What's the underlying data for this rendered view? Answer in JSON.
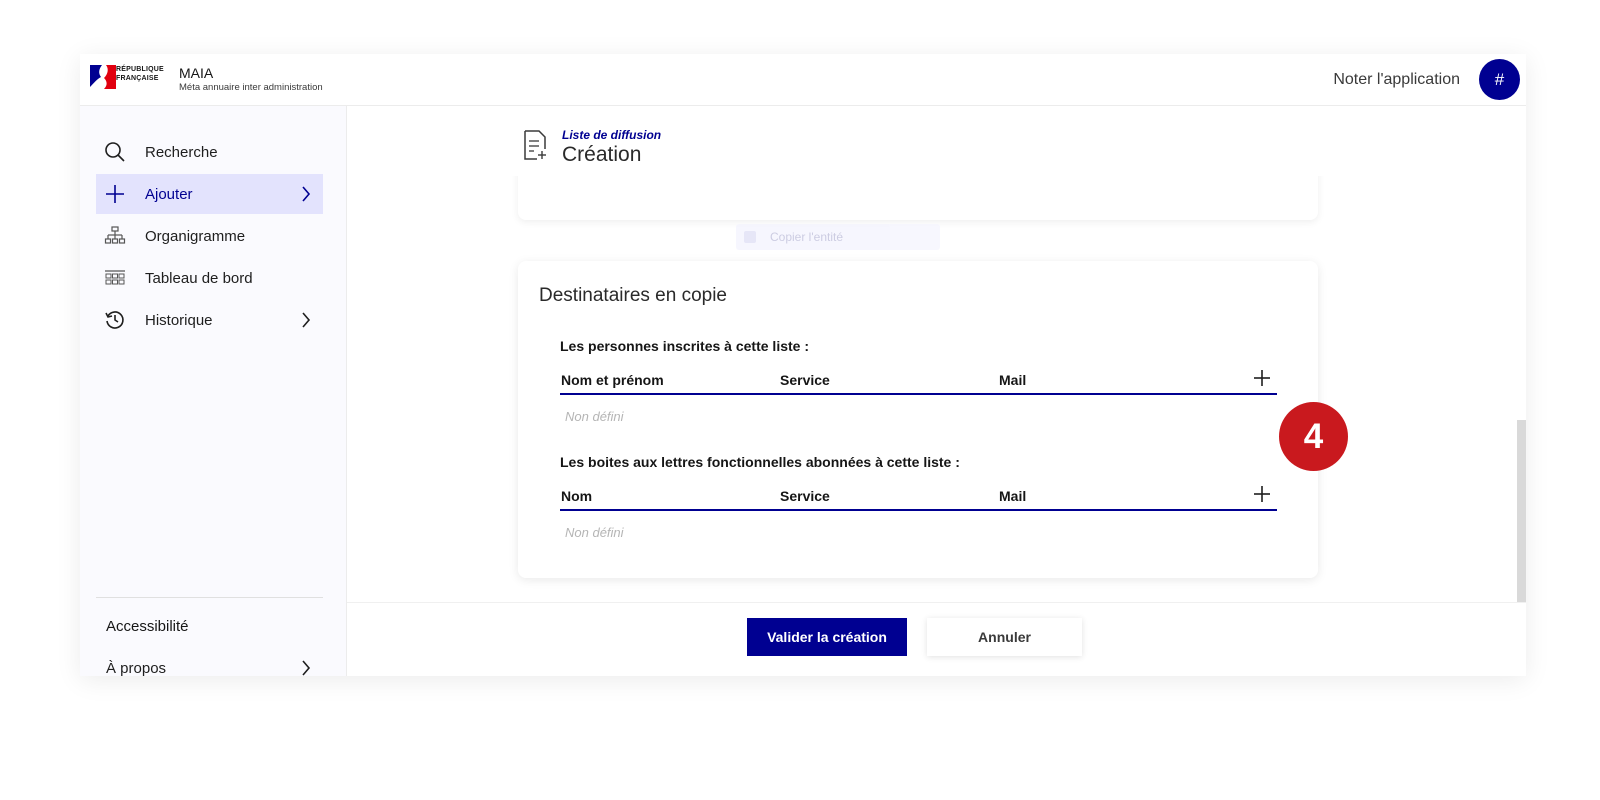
{
  "header": {
    "logo_text_line1": "RÉPUBLIQUE",
    "logo_text_line2": "FRANÇAISE",
    "app_name": "MAIA",
    "app_subtitle": "Méta annuaire inter administration",
    "rate_link": "Noter l'application",
    "avatar_label": "#"
  },
  "sidebar": {
    "items": [
      {
        "label": "Recherche",
        "icon": "search-icon"
      },
      {
        "label": "Ajouter",
        "icon": "plus-icon"
      },
      {
        "label": "Organigramme",
        "icon": "org-chart-icon"
      },
      {
        "label": "Tableau de bord",
        "icon": "dashboard-icon"
      },
      {
        "label": "Historique",
        "icon": "history-icon"
      }
    ],
    "footer_links": [
      {
        "label": "Accessibilité"
      },
      {
        "label": "À propos"
      }
    ]
  },
  "page": {
    "breadcrumb": "Liste de diffusion",
    "title": "Création"
  },
  "card": {
    "title": "Destinataires en copie",
    "persons_label": "Les personnes inscrites à cette liste :",
    "persons_columns": [
      "Nom et prénom",
      "Service",
      "Mail"
    ],
    "persons_empty": "Non défini",
    "mailboxes_label": "Les boites aux lettres fonctionnelles abonnées à cette liste :",
    "mailboxes_columns": [
      "Nom",
      "Service",
      "Mail"
    ],
    "mailboxes_empty": "Non défini"
  },
  "ghost_text": "Copier l'entité",
  "footer": {
    "submit_label": "Valider la création",
    "cancel_label": "Annuler"
  },
  "step_badge": "4",
  "colors": {
    "primary": "#000091",
    "badge": "#c9191e",
    "active_nav_bg": "#e3e3fd"
  }
}
